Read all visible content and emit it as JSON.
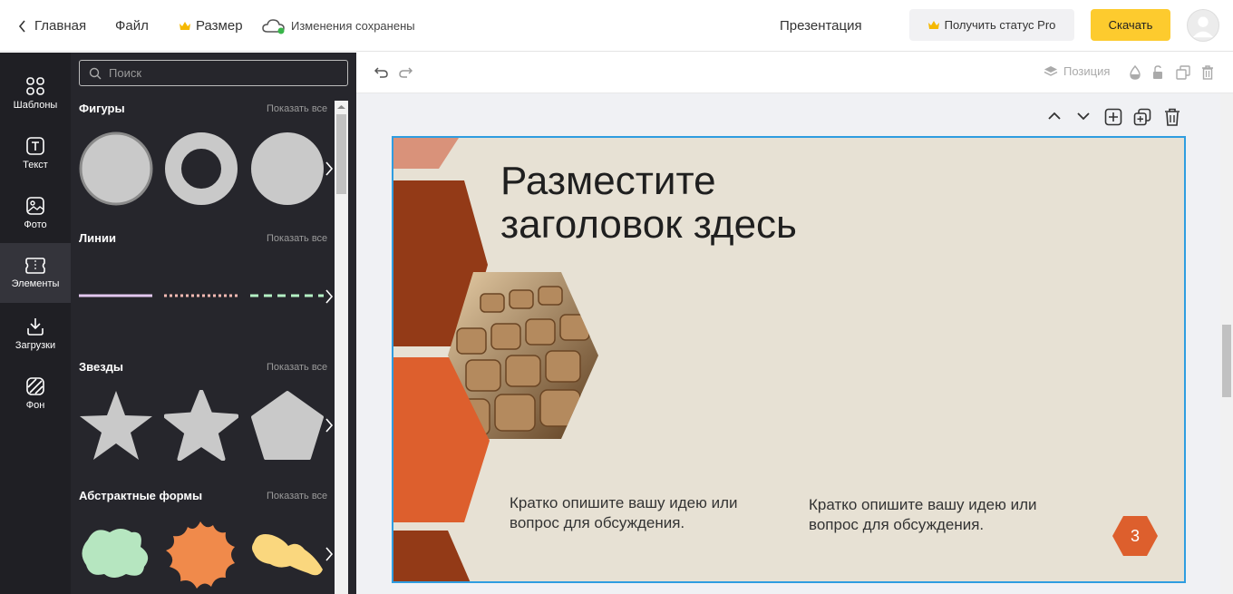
{
  "topbar": {
    "home_label": "Главная",
    "file_label": "Файл",
    "size_label": "Размер",
    "saved_status": "Изменения сохранены",
    "doc_type": "Презентация",
    "pro_label": "Получить статус Pro",
    "download_label": "Скачать"
  },
  "rail": {
    "items": [
      {
        "label": "Шаблоны",
        "icon": "templates-icon"
      },
      {
        "label": "Текст",
        "icon": "text-icon"
      },
      {
        "label": "Фото",
        "icon": "photo-icon"
      },
      {
        "label": "Элементы",
        "icon": "elements-icon",
        "active": true
      },
      {
        "label": "Загрузки",
        "icon": "upload-icon"
      },
      {
        "label": "Фон",
        "icon": "background-icon"
      }
    ]
  },
  "panel": {
    "search_placeholder": "Поиск",
    "show_all": "Показать все",
    "sections": [
      {
        "title": "Фигуры"
      },
      {
        "title": "Линии"
      },
      {
        "title": "Звезды"
      },
      {
        "title": "Абстрактные формы"
      }
    ]
  },
  "editor": {
    "position_label": "Позиция"
  },
  "slide": {
    "title_line1": "Разместите",
    "title_line2": "заголовок здесь",
    "text_left": "Кратко опишите вашу идею или вопрос для обсуждения.",
    "text_right": "Кратко опишите вашу идею или вопрос для обсуждения.",
    "page_number": "3"
  },
  "colors": {
    "accent_yellow": "#fdcb2e",
    "selection_blue": "#2f9de0",
    "slide_bg": "#e7e1d4",
    "hex_dark": "#933a17",
    "hex_orange": "#dd5f2d",
    "hex_light": "#d9927a"
  }
}
